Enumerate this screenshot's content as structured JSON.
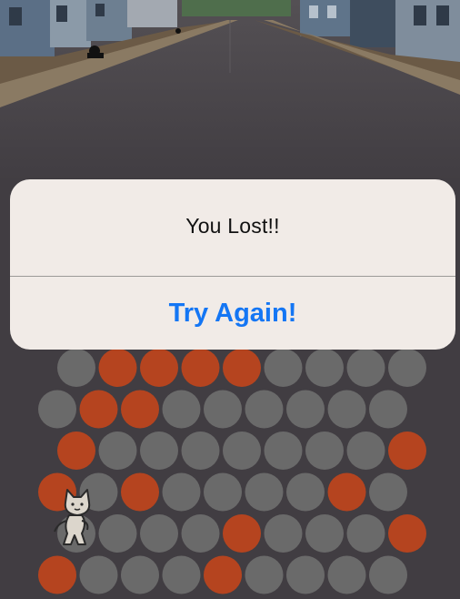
{
  "dialog": {
    "title": "You Lost!!",
    "button_label": "Try Again!"
  },
  "board": {
    "rows": [
      {
        "shift": "right",
        "cells": [
          "empty",
          "blocked",
          "blocked",
          "blocked",
          "blocked",
          "empty",
          "empty",
          "empty",
          "empty"
        ]
      },
      {
        "shift": "left",
        "cells": [
          "empty",
          "blocked",
          "blocked",
          "empty",
          "empty",
          "empty",
          "empty",
          "empty",
          "empty"
        ]
      },
      {
        "shift": "right",
        "cells": [
          "blocked",
          "empty",
          "empty",
          "empty",
          "empty",
          "empty",
          "empty",
          "empty",
          "blocked"
        ]
      },
      {
        "shift": "left",
        "cells": [
          "blocked",
          "empty",
          "blocked",
          "empty",
          "empty",
          "empty",
          "empty",
          "blocked",
          "empty"
        ]
      },
      {
        "shift": "right",
        "cells": [
          "empty",
          "empty",
          "empty",
          "empty",
          "blocked",
          "empty",
          "empty",
          "empty",
          "blocked"
        ]
      },
      {
        "shift": "left",
        "cells": [
          "blocked",
          "empty",
          "empty",
          "empty",
          "blocked",
          "empty",
          "empty",
          "empty",
          "empty"
        ]
      }
    ],
    "cat_position": {
      "row": 4,
      "col": 0
    },
    "colors": {
      "empty": "#6a6a6a",
      "blocked": "#b5441f",
      "background": "#413d42"
    }
  },
  "scene": {
    "description_icon": "street-background"
  }
}
